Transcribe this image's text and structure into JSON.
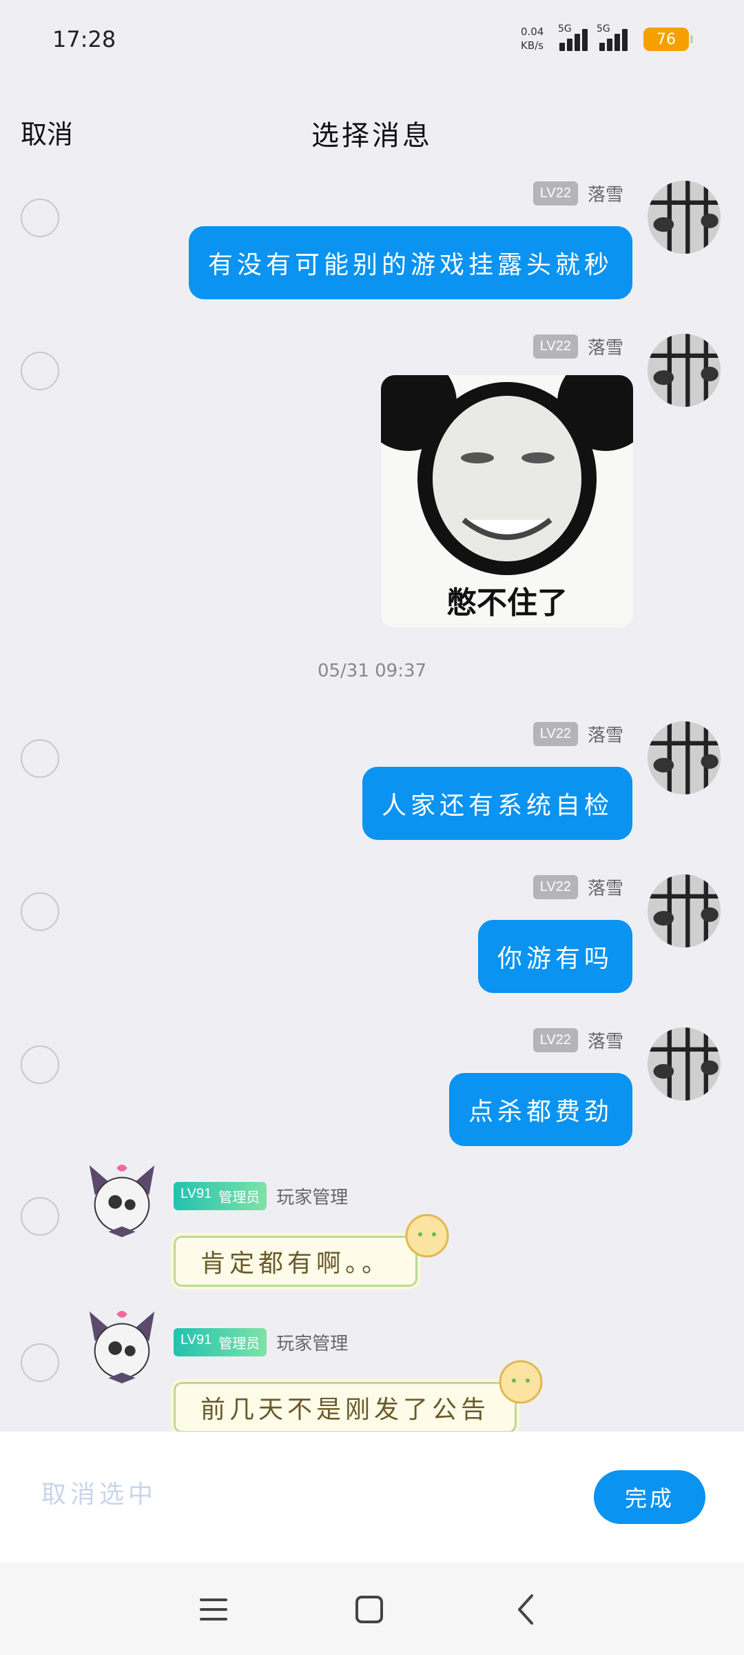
{
  "status": {
    "time": "17:28",
    "net_speed": "0.04",
    "net_unit": "KB/s",
    "sim1": "5G",
    "sim2": "5G",
    "battery": "76"
  },
  "header": {
    "cancel": "取消",
    "title": "选择消息"
  },
  "messages": [
    {
      "level": "LV22",
      "sender": "落雪",
      "text": "有没有可能别的游戏挂露头就秒"
    },
    {
      "level": "LV22",
      "sender": "落雪",
      "sticker_caption": "憋不住了"
    },
    {
      "level": "LV22",
      "sender": "落雪",
      "text": "人家还有系统自检"
    },
    {
      "level": "LV22",
      "sender": "落雪",
      "text": "你游有吗"
    },
    {
      "level": "LV22",
      "sender": "落雪",
      "text": "点杀都费劲"
    },
    {
      "level": "LV91",
      "role": "管理员",
      "sender": "玩家管理",
      "text": "肯定都有啊。。"
    },
    {
      "level": "LV91",
      "role": "管理员",
      "sender": "玩家管理",
      "text": "前几天不是刚发了公告"
    }
  ],
  "timestamp": "05/31 09:37",
  "bottom": {
    "unselect": "取消选中",
    "done": "完成"
  },
  "colors": {
    "accent": "#0a93f0",
    "battery": "#f5a000"
  },
  "nav": {
    "menu": "menu-icon",
    "home": "home-icon",
    "back": "back-icon"
  }
}
